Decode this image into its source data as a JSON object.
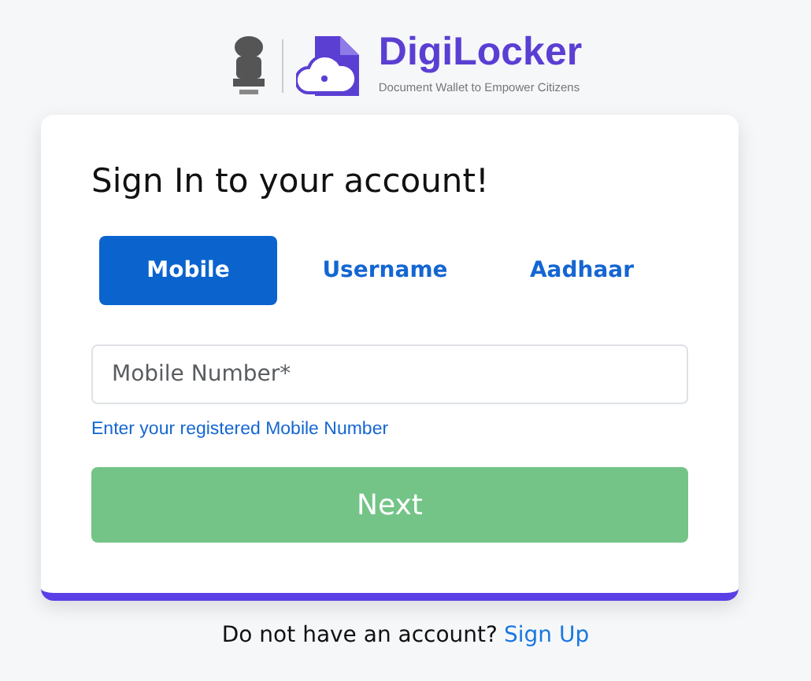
{
  "logo": {
    "name": "DigiLocker",
    "tagline": "Document Wallet to Empower Citizens"
  },
  "title": "Sign In to your account!",
  "tabs": [
    {
      "label": "Mobile",
      "selected": true
    },
    {
      "label": "Username",
      "selected": false
    },
    {
      "label": "Aadhaar",
      "selected": false
    }
  ],
  "field": {
    "placeholder": "Mobile Number*",
    "hint": "Enter your registered Mobile Number"
  },
  "submit": {
    "label": "Next",
    "disabled": true
  },
  "footer": {
    "text": "Do not have an account?",
    "link": "Sign Up"
  }
}
